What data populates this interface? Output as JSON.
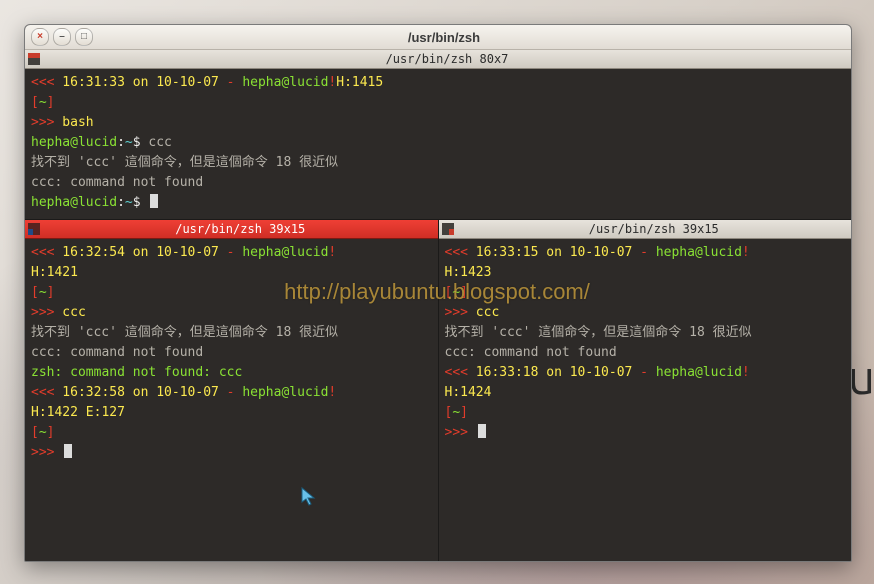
{
  "window": {
    "title": "/usr/bin/zsh",
    "close_glyph": "×",
    "min_glyph": "–",
    "max_glyph": "□"
  },
  "watermark": "http://playubuntu.blogspot.com/",
  "desktop_logo": "ubu",
  "panes": {
    "top": {
      "header": "/usr/bin/zsh 80x7",
      "lines": {
        "l1_a": "<<<",
        "l1_b": " 16:31:33 on 10-10-07 ",
        "l1_c": "-",
        "l1_d": " hepha@lucid",
        "l1_e": "!",
        "l1_f": "H:1415",
        "l2_a": "[",
        "l2_b": "~",
        "l2_c": "]",
        "l3_a": ">>>",
        "l3_b": " bash",
        "l4_a": "hepha@lucid",
        "l4_b": ":",
        "l4_c": "~",
        "l4_d": "$ ",
        "l4_e": "ccc",
        "l5": "找不到 'ccc' 這個命令，但是這個命令 18 很近似",
        "l6": "ccc: command not found",
        "l7_a": "hepha@lucid",
        "l7_b": ":",
        "l7_c": "~",
        "l7_d": "$ "
      }
    },
    "left": {
      "header": "/usr/bin/zsh 39x15",
      "lines": {
        "l1_a": "<<<",
        "l1_b": " 16:32:54 on 10-10-07 ",
        "l1_c": "-",
        "l1_d": " hepha@lucid",
        "l1_e": "!",
        "l2": "H:1421",
        "l3_a": "[",
        "l3_b": "~",
        "l3_c": "]",
        "l4_a": ">>>",
        "l4_b": " ccc",
        "l5": "找不到 'ccc' 這個命令，但是這個命令 18 很近似",
        "l6": "ccc: command not found",
        "l7": "zsh: command not found: ccc",
        "l8_a": "<<<",
        "l8_b": " 16:32:58 on 10-10-07 ",
        "l8_c": "-",
        "l8_d": " hepha@lucid",
        "l8_e": "!",
        "l9": "H:1422 E:127",
        "l10_a": "[",
        "l10_b": "~",
        "l10_c": "]",
        "l11_a": ">>>",
        "l11_b": " "
      }
    },
    "right": {
      "header": "/usr/bin/zsh 39x15",
      "lines": {
        "l1_a": "<<<",
        "l1_b": " 16:33:15 on 10-10-07 ",
        "l1_c": "-",
        "l1_d": " hepha@lucid",
        "l1_e": "!",
        "l2": "H:1423",
        "l3_a": "[",
        "l3_b": "~",
        "l3_c": "]",
        "l4_a": ">>>",
        "l4_b": " ccc",
        "l5": "找不到 'ccc' 這個命令，但是這個命令 18 很近似",
        "l6": "ccc: command not found",
        "l7_a": "<<<",
        "l7_b": " 16:33:18 on 10-10-07 ",
        "l7_c": "-",
        "l7_d": " hepha@lucid",
        "l7_e": "!",
        "l8": "H:1424",
        "l9_a": "[",
        "l9_b": "~",
        "l9_c": "]",
        "l10_a": ">>>",
        "l10_b": " "
      }
    }
  }
}
